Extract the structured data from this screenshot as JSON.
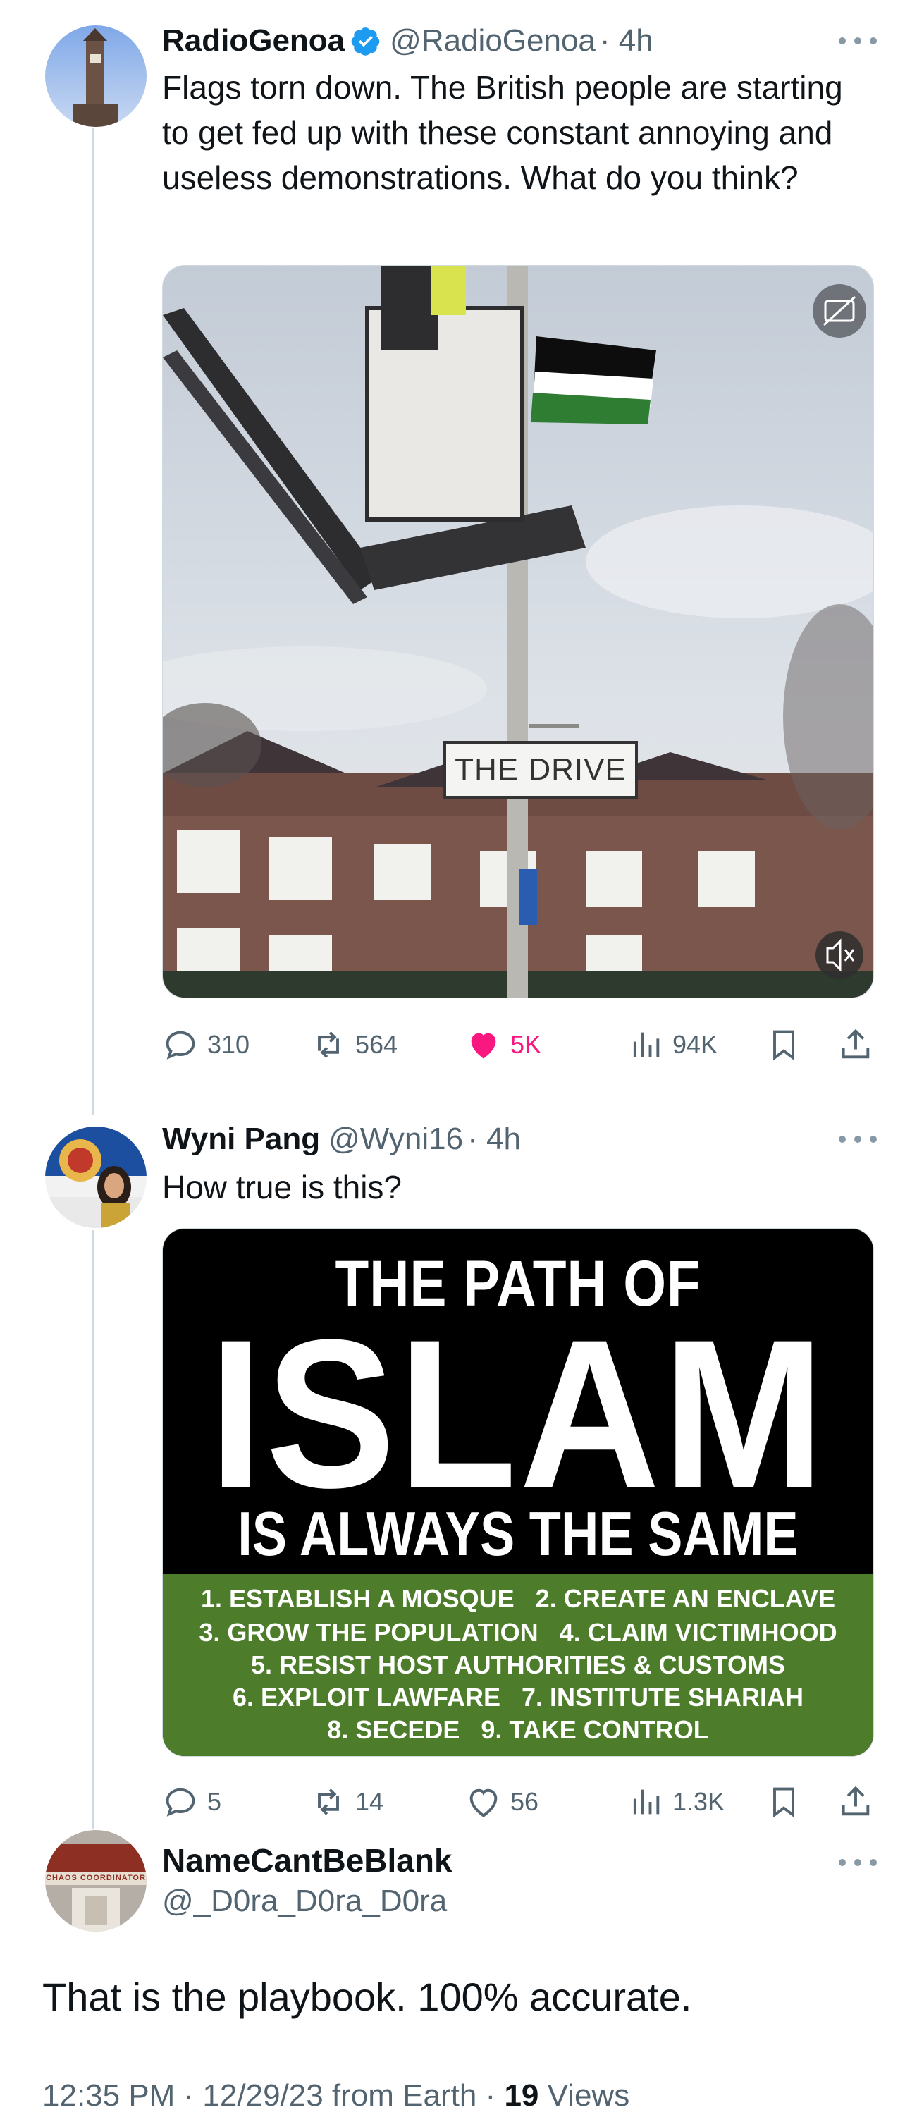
{
  "tweets": [
    {
      "name": "RadioGenoa",
      "handle": "@RadioGenoa",
      "time": "· 4h",
      "verified": true,
      "text": "Flags torn down. The British people are starting to get fed up with these constant annoying and useless demonstrations. What do you think?",
      "media": {
        "street_sign": "THE DRIVE",
        "cc_icon": "captions-icon",
        "mute_icon": "mute-icon"
      },
      "stats": {
        "replies": "310",
        "reposts": "564",
        "likes": "5K",
        "views": "94K"
      }
    },
    {
      "name": "Wyni Pang",
      "handle": "@Wyni16",
      "time": "· 4h",
      "verified": false,
      "text": "How true is this?",
      "media": {
        "line1": "THE PATH OF",
        "line2": "ISLAM",
        "line3": "IS ALWAYS THE SAME",
        "steps": [
          "1. ESTABLISH A MOSQUE   2. CREATE AN ENCLAVE",
          "3. GROW THE POPULATION   4. CLAIM VICTIMHOOD",
          "5. RESIST HOST AUTHORITIES & CUSTOMS",
          "6. EXPLOIT LAWFARE   7. INSTITUTE SHARIAH",
          "8. SECEDE   9. TAKE CONTROL"
        ]
      },
      "stats": {
        "replies": "5",
        "reposts": "14",
        "likes": "56",
        "views": "1.3K"
      }
    }
  ],
  "focus": {
    "name": "NameCantBeBlank",
    "handle": "@_D0ra_D0ra_D0ra",
    "avatar_text": "CHAOS COORDINATOR",
    "text": "That is the playbook. 100% accurate.",
    "time": "12:35 PM · 12/29/23 from Earth ·",
    "views_count": "19",
    "views_label": "Views"
  },
  "colors": {
    "like": "#f91880",
    "verified": "#1d9bf0",
    "muted": "#536471",
    "thread": "#cfd9de"
  }
}
